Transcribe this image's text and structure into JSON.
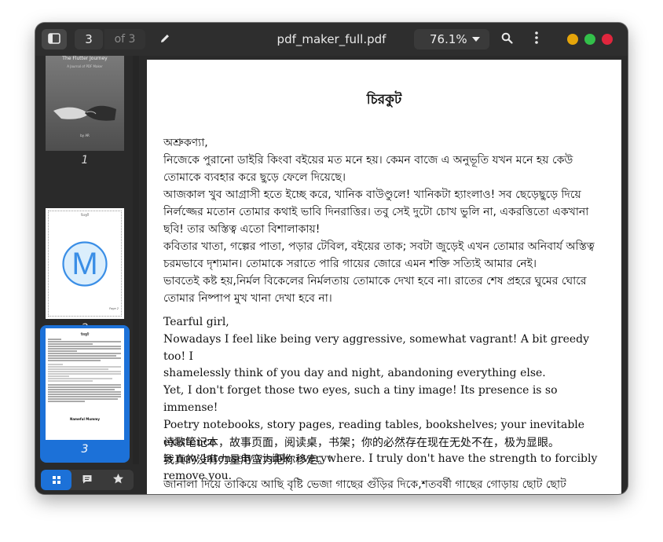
{
  "headerbar": {
    "current_page": "3",
    "page_total_label": "of 3",
    "title": "pdf_maker_full.pdf",
    "zoom_level": "76.1%",
    "icons": [
      "sidebar-icon",
      "pencil-icon",
      "search-icon",
      "kebab-menu-icon"
    ]
  },
  "sidebar": {
    "thumbnails": [
      {
        "label": "1",
        "cover_title": "The Flutter Journey",
        "cover_subtitle": "A Journal of PDF Maker",
        "cover_author": "by AR"
      },
      {
        "label": "2",
        "header_text": "চিরকুট",
        "logo_letter": "M",
        "footer_text": "Page 2"
      },
      {
        "label": "3",
        "header_text": "চিরকুট",
        "footer_text": "Nameful Mummy"
      }
    ],
    "tabs": [
      "thumbnails",
      "annotations",
      "bookmarks"
    ],
    "active_tab": "thumbnails",
    "colors": {
      "selection": "#1c71d8",
      "logo": "#3a8ee6"
    }
  },
  "document": {
    "title": "চিরকুট",
    "bengali_paragraph": "অশ্রুকণ্যা,\nনিজেকে পুরানো ডাইরি কিংবা বইয়ের মত মনে হয়। কেমন বাজে এ অনুভূতি যখন মনে হয় কেউ\nতোমাকে ব্যবহার করে ছুড়ে ফেলে দিয়েছে।\nআজকাল খুব আগ্রাসী হতে ইচ্ছে করে, খানিক বাউণ্ডুলে! খানিকটা হ্যাংলাও! সব ছেড়েছুড়ে দিয়ে\nনির্লজ্জের মতোন তোমার কথাই ভাবি দিনরাত্তির। তবু সেই দুটো চোখ ভুলি না, একরত্তিতো একখানা\nছবি! তার অস্তিত্ব এতো বিশালাকায়!\nকবিতার খাতা, গল্পের পাতা, পড়ার টেবিল, বইয়ের তাক; সবটা জুড়েই এখন তোমার অনিবার্য অস্তিত্ব\nচরমভাবে দৃশ্যমান। তোমাকে সরাতে পারি গায়ের জোরে এমন শক্তি সত্যিই আমার নেই।\nভাবতেই কষ্ট হয়,নির্মল বিকেলের নির্মলতায় তোমাকে দেখা হবে না। রাতের শেষ প্রহরে ঘুমের ঘোরে\nতোমার নিষ্পাপ মুখ খানা দেখা হবে না।",
    "english_paragraph": "Tearful girl,\nNowadays I feel like being very aggressive, somewhat vagrant! A bit greedy too! I\nshamelessly think of you day and night, abandoning everything else.\n Yet, I don't forget those two eyes, such a tiny image! Its presence is so immense!\nPoetry notebooks, story pages, reading tables, bookshelves; your inevitable existence\nis now intensely visible everywhere. I truly don't have the strength to forcibly\nremove you.",
    "chinese_paragraph": "诗歌笔记本，故事页面，阅读桌，书架；你的必然存在现在无处不在，极为显眼。\n我真的没有力量用蛮力把你移走。'",
    "bengali_trailing": "জানালা দিয়ে তাকিয়ে আছি বৃষ্টি ভেজা গাছের গুঁড়ির দিকে,শতবর্ষী গাছের গোড়ায় ছোট ছোট"
  }
}
